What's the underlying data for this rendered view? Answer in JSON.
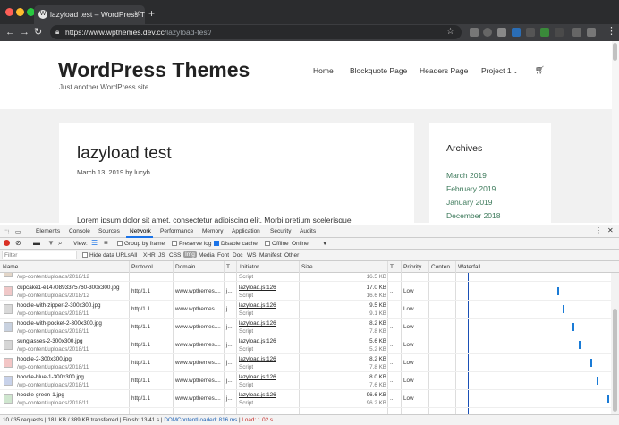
{
  "browser": {
    "tab_title": "lazyload test – WordPress The",
    "tab_favicon": "wordpress-icon",
    "url_host": "https://www.wpthemes.dev.cc",
    "url_path": "/lazyload-test/"
  },
  "site": {
    "title": "WordPress Themes",
    "description": "Just another WordPress site",
    "menu": [
      "Home",
      "Blockquote Page",
      "Headers Page",
      "Project 1"
    ],
    "cart_icon": "cart-icon",
    "post": {
      "title": "lazyload test",
      "date": "March 13, 2019",
      "by": "by",
      "author": "lucyb",
      "excerpt": "Lorem ipsum dolor sit amet, consectetur adipiscing elit. Morbi pretium scelerisque"
    },
    "archives": {
      "title": "Archives",
      "items": [
        "March 2019",
        "February 2019",
        "January 2019",
        "December 2018"
      ]
    },
    "colors": {
      "link": "#3d7a5b",
      "background": "#f1f1f1"
    }
  },
  "devtools": {
    "tabs": [
      "Elements",
      "Console",
      "Sources",
      "Network",
      "Performance",
      "Memory",
      "Application",
      "Security",
      "Audits"
    ],
    "active_tab": "Network",
    "controls": {
      "view_label": "View:",
      "group_by_frame": "Group by frame",
      "preserve_log": "Preserve log",
      "disable_cache": "Disable cache",
      "offline": "Offline",
      "throttle": "Online"
    },
    "filter": {
      "placeholder": "Filter",
      "hide_data_urls": "Hide data URLs",
      "types": [
        "All",
        "XHR",
        "JS",
        "CSS",
        "Img",
        "Media",
        "Font",
        "Doc",
        "WS",
        "Manifest",
        "Other"
      ],
      "active_type": "Img"
    },
    "columns": [
      "Name",
      "Protocol",
      "Domain",
      "T...",
      "Initiator",
      "Size",
      "T...",
      "Priority",
      "Conten...",
      "Waterfall"
    ],
    "rows": [
      {
        "name": "",
        "path": "/wp-content/uploads/2018/12",
        "protocol": "",
        "domain": "",
        "type": "",
        "initiator": "",
        "initiator_type": "Script",
        "size": "",
        "size_res": "16.5 KB",
        "time": "",
        "priority": ""
      },
      {
        "name": "cupcake1-e1470893375760-300x300.jpg",
        "path": "/wp-content/uploads/2018/12",
        "protocol": "http/1.1",
        "domain": "www.wpthemes....",
        "type": "j...",
        "initiator": "lazyload.js:126",
        "initiator_type": "Script",
        "size": "17.0 KB",
        "size_res": "16.6 KB",
        "time": "...",
        "priority": "Low"
      },
      {
        "name": "hoodie-with-zipper-2-300x300.jpg",
        "path": "/wp-content/uploads/2018/11",
        "protocol": "http/1.1",
        "domain": "www.wpthemes....",
        "type": "j...",
        "initiator": "lazyload.js:126",
        "initiator_type": "Script",
        "size": "9.5 KB",
        "size_res": "9.1 KB",
        "time": "...",
        "priority": "Low"
      },
      {
        "name": "hoodie-with-pocket-2-300x300.jpg",
        "path": "/wp-content/uploads/2018/11",
        "protocol": "http/1.1",
        "domain": "www.wpthemes....",
        "type": "j...",
        "initiator": "lazyload.js:126",
        "initiator_type": "Script",
        "size": "8.2 KB",
        "size_res": "7.8 KB",
        "time": "...",
        "priority": "Low"
      },
      {
        "name": "sunglasses-2-300x300.jpg",
        "path": "/wp-content/uploads/2018/11",
        "protocol": "http/1.1",
        "domain": "www.wpthemes....",
        "type": "j...",
        "initiator": "lazyload.js:126",
        "initiator_type": "Script",
        "size": "5.6 KB",
        "size_res": "5.2 KB",
        "time": "...",
        "priority": "Low"
      },
      {
        "name": "hoodie-2-300x300.jpg",
        "path": "/wp-content/uploads/2018/11",
        "protocol": "http/1.1",
        "domain": "www.wpthemes....",
        "type": "j...",
        "initiator": "lazyload.js:126",
        "initiator_type": "Script",
        "size": "8.2 KB",
        "size_res": "7.8 KB",
        "time": "...",
        "priority": "Low"
      },
      {
        "name": "hoodie-blue-1-300x300.jpg",
        "path": "/wp-content/uploads/2018/11",
        "protocol": "http/1.1",
        "domain": "www.wpthemes....",
        "type": "j...",
        "initiator": "lazyload.js:126",
        "initiator_type": "Script",
        "size": "8.0 KB",
        "size_res": "7.6 KB",
        "time": "...",
        "priority": "Low"
      },
      {
        "name": "hoodie-green-1.jpg",
        "path": "/wp-content/uploads/2018/11",
        "protocol": "http/1.1",
        "domain": "www.wpthemes....",
        "type": "j...",
        "initiator": "lazyload.js:126",
        "initiator_type": "Script",
        "size": "96.6 KB",
        "size_res": "96.2 KB",
        "time": "...",
        "priority": "Low"
      }
    ],
    "status": {
      "requests": "10 / 35 requests",
      "transferred": "181 KB / 389 KB transferred",
      "finish": "Finish: 13.41 s",
      "dom_content_loaded": "DOMContentLoaded: 816 ms",
      "load": "Load: 1.02 s"
    }
  }
}
